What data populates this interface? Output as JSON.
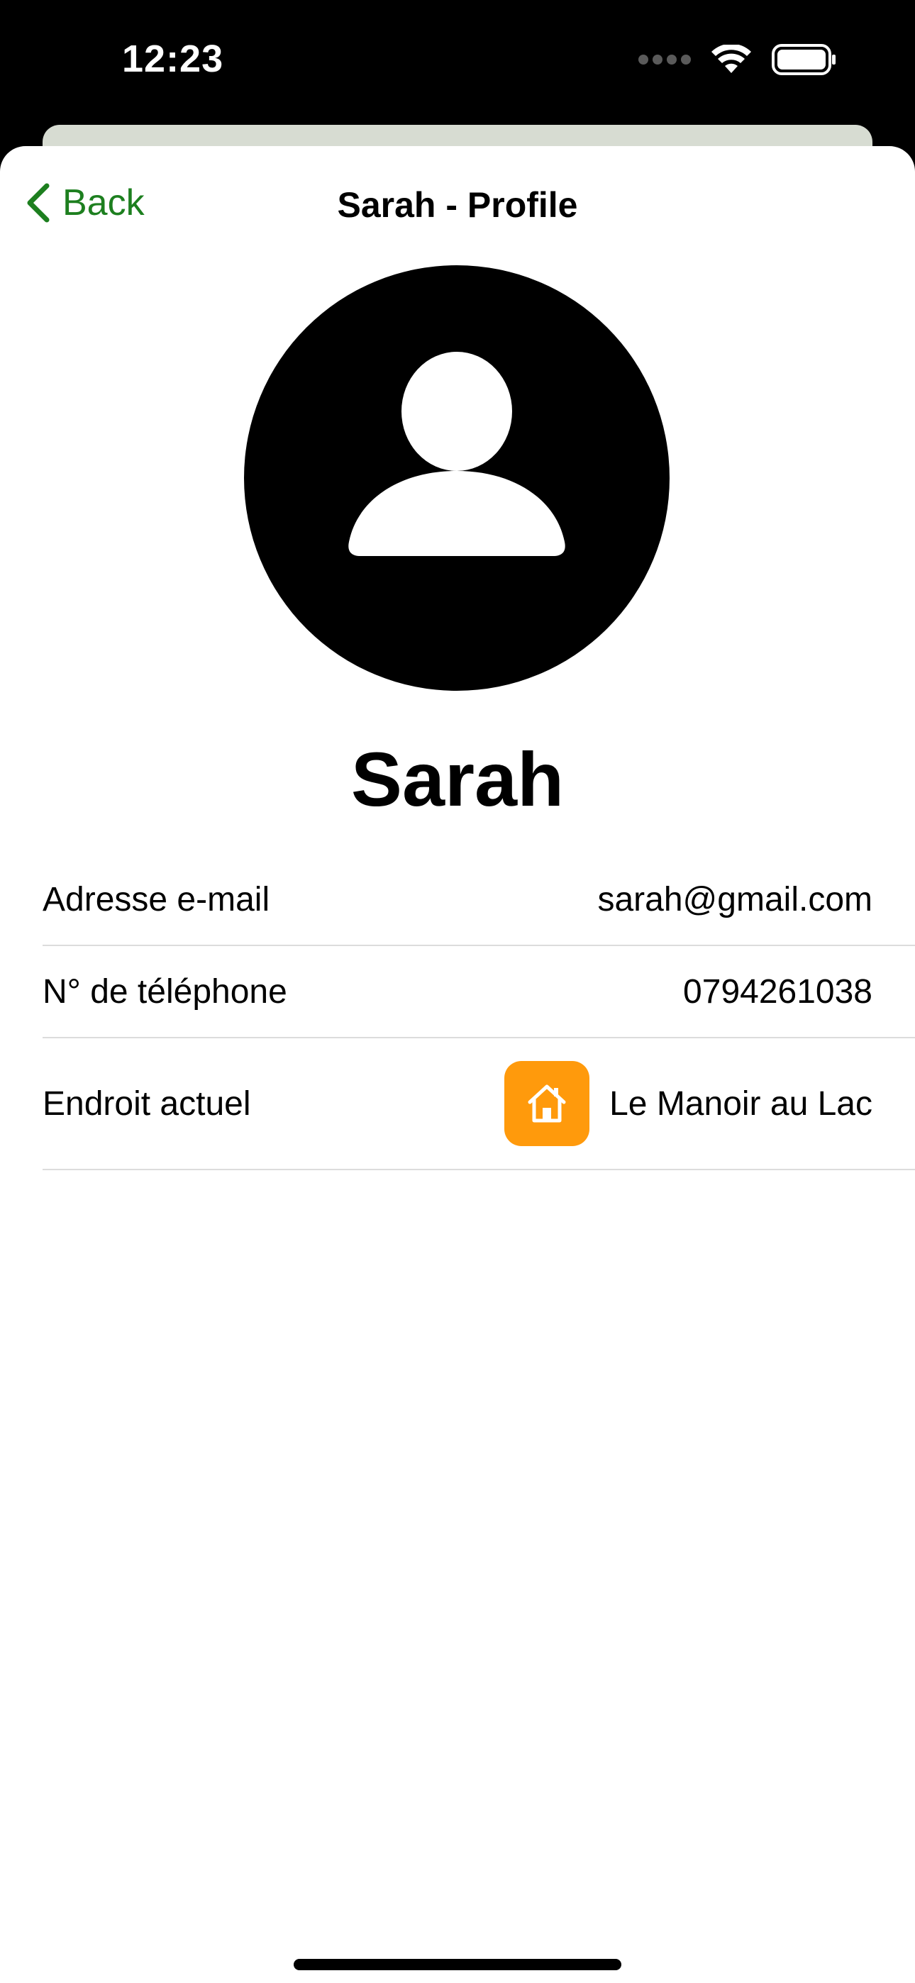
{
  "status_bar": {
    "time": "12:23",
    "icons": [
      "cellular-icon",
      "wifi-icon",
      "battery-icon"
    ]
  },
  "nav": {
    "back_label": "Back",
    "title": "Sarah - Profile"
  },
  "profile": {
    "name": "Sarah",
    "avatar_icon": "person-circle-icon"
  },
  "details": [
    {
      "label": "Adresse e-mail",
      "value": "sarah@gmail.com"
    },
    {
      "label": "N° de téléphone",
      "value": "0794261038"
    },
    {
      "label": "Endroit actuel",
      "value": "Le Manoir au Lac",
      "icon": "house-icon"
    }
  ],
  "colors": {
    "accent": "#1d7f1f",
    "place_icon_bg": "#ff9a0c",
    "separator": "#dcdcdc"
  }
}
